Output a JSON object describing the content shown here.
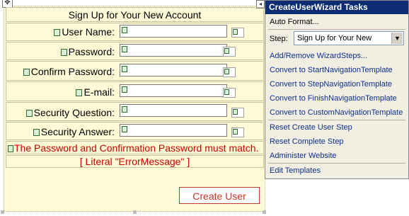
{
  "designer": {
    "title": "Sign Up for Your New Account",
    "fields": [
      {
        "label": "User Name:"
      },
      {
        "label": "Password:"
      },
      {
        "label": "Confirm Password:"
      },
      {
        "label": "E-mail:"
      },
      {
        "label": "Security Question:"
      },
      {
        "label": "Security Answer:"
      }
    ],
    "compare_message": "The Password and Confirmation Password must match.",
    "error_literal": "[ Literal \"ErrorMessage\" ]",
    "create_button": "Create User"
  },
  "panel": {
    "title": "CreateUserWizard Tasks",
    "auto_format": "Auto Format...",
    "step_label": "Step:",
    "step_value": "Sign Up for Your New",
    "links": [
      "Add/Remove WizardSteps...",
      "Convert to StartNavigationTemplate",
      "Convert to StepNavigationTemplate",
      "Convert to FinishNavigationTemplate",
      "Convert to CustomNavigationTemplate",
      "Reset Create User Step",
      "Reset Complete Step",
      "Administer Website",
      "Edit Templates"
    ]
  },
  "colors": {
    "panel_title_bg": "#0c2c74",
    "link": "#0d2f8c",
    "error": "#cc0000",
    "designer_bg": "#fffbd6"
  }
}
